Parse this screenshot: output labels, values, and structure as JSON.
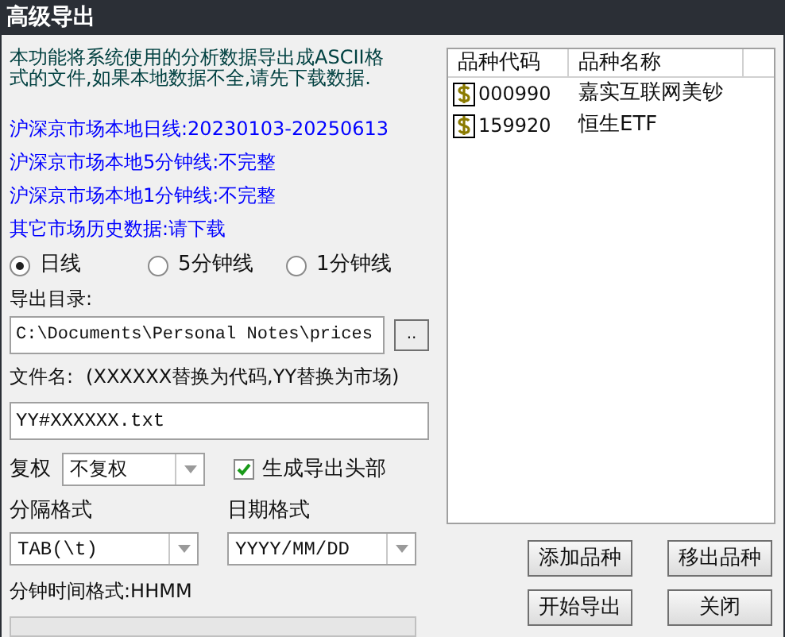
{
  "window": {
    "title": "高级导出"
  },
  "intro": "本功能将系统使用的分析数据导出成ASCII格式的文件,如果本地数据不全,请先下载数据.",
  "status_lines": [
    "沪深京市场本地日线:20230103-20250613",
    "沪深京市场本地5分钟线:不完整",
    "沪深京市场本地1分钟线:不完整",
    "其它市场历史数据:请下载"
  ],
  "period_options": [
    {
      "label": "日线",
      "selected": true
    },
    {
      "label": "5分钟线",
      "selected": false
    },
    {
      "label": "1分钟线",
      "selected": false
    }
  ],
  "export_dir": {
    "label": "导出目录:",
    "value": "C:\\Documents\\Personal Notes\\prices",
    "browse_button": ".."
  },
  "file_name": {
    "label": "文件名:",
    "hint": "(XXXXXX替换为代码,YY替换为市场)",
    "value": "YY#XXXXXX.txt"
  },
  "adjust": {
    "label": "复权",
    "value": "不复权"
  },
  "header_checkbox": {
    "label": "生成导出头部",
    "checked": true
  },
  "separator": {
    "label": "分隔格式",
    "value": "TAB(\\t)"
  },
  "date_format": {
    "label": "日期格式",
    "value": "YYYY/MM/DD"
  },
  "minute_format": "分钟时间格式:HHMM",
  "table": {
    "columns": [
      "品种代码",
      "品种名称"
    ],
    "rows": [
      {
        "code": "000990",
        "name": "嘉实互联网美钞"
      },
      {
        "code": "159920",
        "name": "恒生ETF"
      }
    ]
  },
  "buttons": [
    "添加品种",
    "移出品种",
    "开始导出",
    "关闭"
  ]
}
